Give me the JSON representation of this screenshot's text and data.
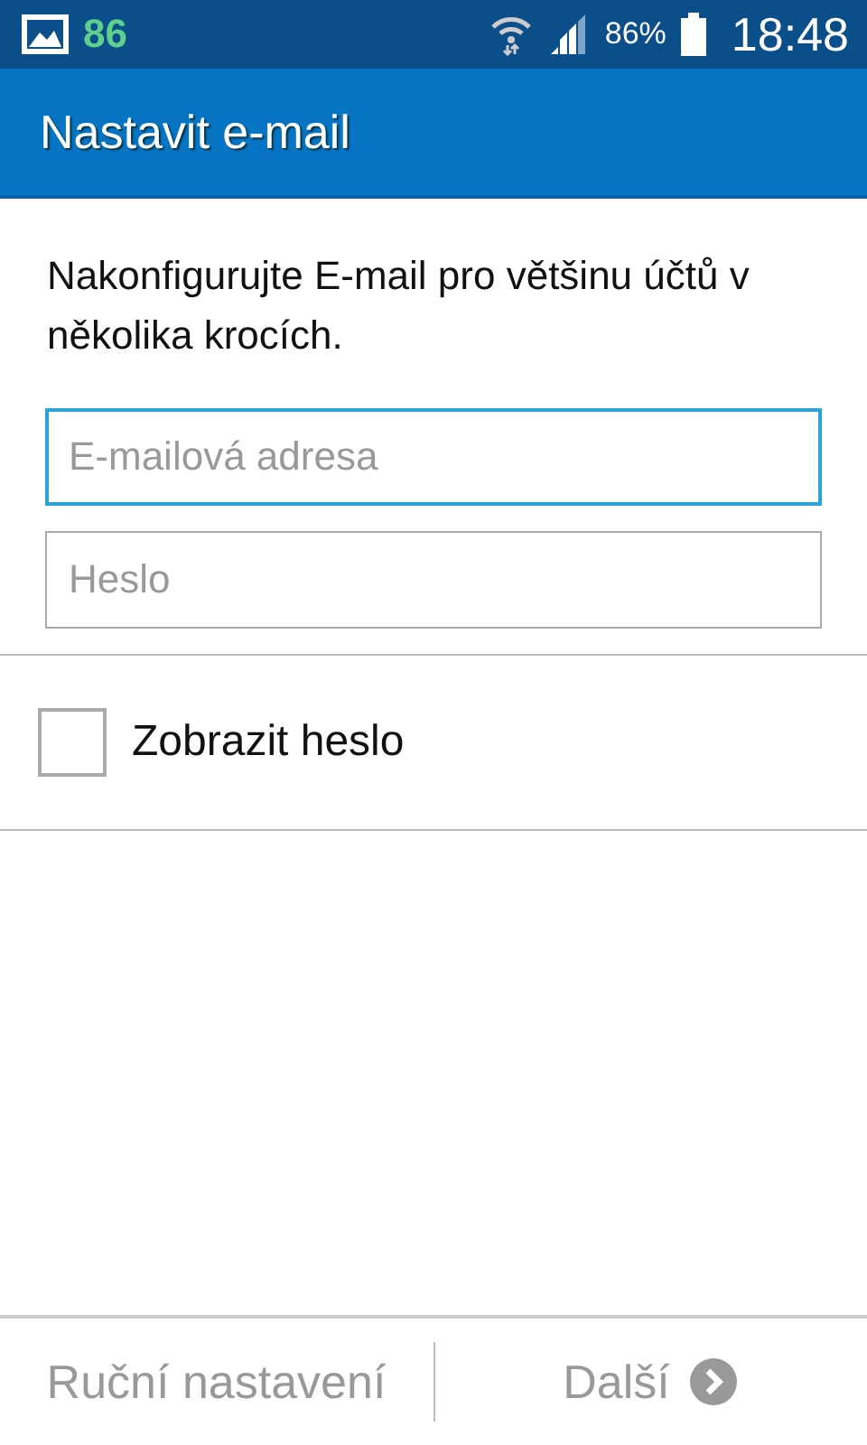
{
  "status_bar": {
    "notification_count": "86",
    "battery": "86%",
    "time": "18:48"
  },
  "app_bar": {
    "title": "Nastavit e-mail"
  },
  "intro": "Nakonfigurujte E-mail pro většinu účtů v několika krocích.",
  "fields": [
    {
      "placeholder": "E-mailová adresa",
      "focused": true
    },
    {
      "placeholder": "Heslo",
      "focused": false
    }
  ],
  "show_password": {
    "label": "Zobrazit heslo",
    "checked": false
  },
  "buttons": [
    {
      "label": "Ruční nastavení",
      "disabled": true,
      "kind": "plain"
    },
    {
      "label": "Další",
      "disabled": true,
      "kind": "next"
    }
  ]
}
